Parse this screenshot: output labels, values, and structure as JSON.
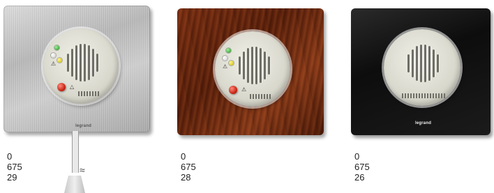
{
  "products": [
    {
      "code": "0 675 29",
      "finish": "aluminium",
      "brand": "legrand",
      "icons": [
        "green-led-icon",
        "white-led-icon",
        "warning-icon",
        "yellow-led-icon",
        "red-test-button-icon",
        "flame-icon"
      ]
    },
    {
      "code": "0 675 28",
      "finish": "wood",
      "brand": "legrand",
      "icons": [
        "green-led-icon",
        "white-led-icon",
        "warning-icon",
        "yellow-led-icon",
        "red-test-button-icon",
        "warning-icon"
      ]
    },
    {
      "code": "0 675 26",
      "finish": "black",
      "brand": "legrand",
      "icons": []
    }
  ],
  "colors": {
    "steel": "#c4c4c4",
    "wood": "#6a2810",
    "black": "#121212",
    "disc": "#e2e1d7",
    "red_button": "#c11a0a"
  }
}
